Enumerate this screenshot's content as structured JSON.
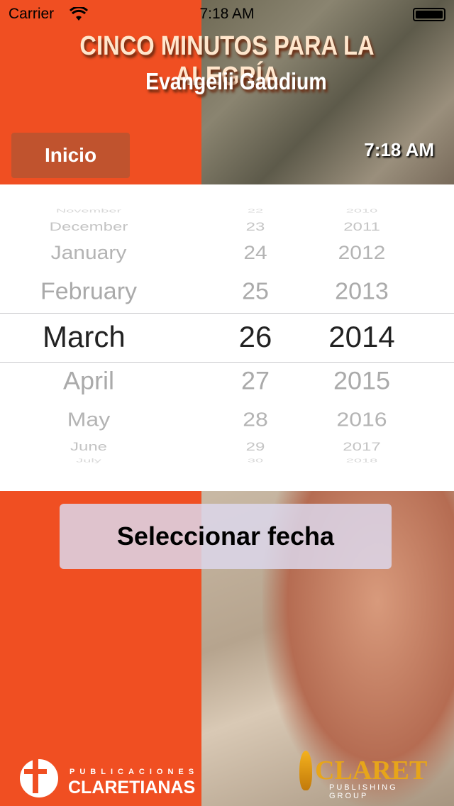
{
  "status_bar": {
    "carrier": "Carrier",
    "time": "7:18 AM"
  },
  "header": {
    "title": "CINCO MINUTOS PARA LA ALEGRÍA",
    "subtitle": "Evangelii Gaudium",
    "inicio_label": "Inicio",
    "clock": "7:18 AM"
  },
  "picker": {
    "months": [
      "November",
      "December",
      "January",
      "February",
      "March",
      "April",
      "May",
      "June",
      "July"
    ],
    "days": [
      "22",
      "23",
      "24",
      "25",
      "26",
      "27",
      "28",
      "29",
      "30"
    ],
    "years": [
      "2010",
      "2011",
      "2012",
      "2013",
      "2014",
      "2015",
      "2016",
      "2017",
      "2018"
    ],
    "selected": {
      "month": "March",
      "day": "26",
      "year": "2014"
    }
  },
  "select_button_label": "Seleccionar fecha",
  "logos": {
    "left_top": "PUBLICACIONES",
    "left_bottom": "CLARETIANAS",
    "right_top": "CLARET",
    "right_bottom": "PUBLISHING GROUP"
  },
  "colors": {
    "accent": "#f04f22",
    "button": "#c0532e"
  }
}
